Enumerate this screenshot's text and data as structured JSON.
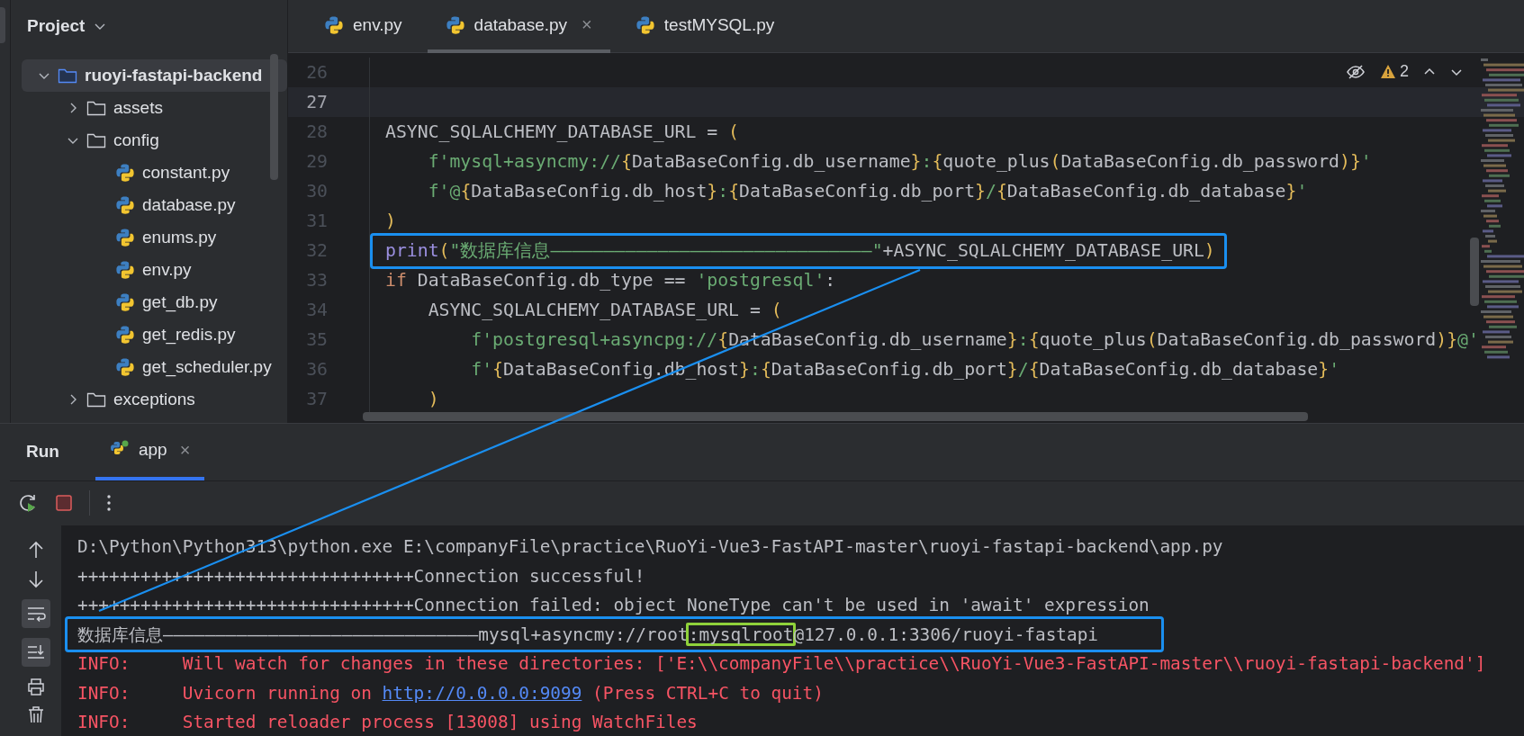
{
  "project_panel": {
    "title": "Project",
    "tree": [
      {
        "name": "ruoyi-fastapi-backend",
        "kind": "folder",
        "expanded": true,
        "selected": true,
        "children": [
          {
            "name": "assets",
            "kind": "folder",
            "expanded": false,
            "selected": false
          },
          {
            "name": "config",
            "kind": "folder",
            "expanded": true,
            "selected": false,
            "children": [
              {
                "name": "constant.py",
                "kind": "python",
                "selected": false
              },
              {
                "name": "database.py",
                "kind": "python",
                "selected": false
              },
              {
                "name": "enums.py",
                "kind": "python",
                "selected": false
              },
              {
                "name": "env.py",
                "kind": "python",
                "selected": false
              },
              {
                "name": "get_db.py",
                "kind": "python",
                "selected": false
              },
              {
                "name": "get_redis.py",
                "kind": "python",
                "selected": false
              },
              {
                "name": "get_scheduler.py",
                "kind": "python",
                "selected": false
              }
            ]
          },
          {
            "name": "exceptions",
            "kind": "folder",
            "expanded": false,
            "selected": false
          }
        ]
      }
    ]
  },
  "editor": {
    "tabs": [
      {
        "label": "env.py",
        "selected": false
      },
      {
        "label": "database.py",
        "selected": true,
        "close": "×"
      },
      {
        "label": "testMYSQL.py",
        "selected": false
      }
    ],
    "warnings": "2",
    "lines": [
      {
        "number": "26",
        "current": false
      },
      {
        "number": "27",
        "current": true
      },
      {
        "number": "28",
        "current": false,
        "tokens": [
          {
            "text": "ASYNC_SQLALCHEMY_DATABASE_URL = ",
            "kind": "plain"
          },
          {
            "text": "(",
            "kind": "brace"
          }
        ]
      },
      {
        "number": "29",
        "current": false,
        "tokens": [
          {
            "text": "    f'mysql+asyncmy://",
            "kind": "str"
          },
          {
            "text": "{",
            "kind": "brace"
          },
          {
            "text": "DataBaseConfig.db_username",
            "kind": "plain"
          },
          {
            "text": "}",
            "kind": "brace"
          },
          {
            "text": ":",
            "kind": "str"
          },
          {
            "text": "{",
            "kind": "brace"
          },
          {
            "text": "quote_plus",
            "kind": "plain"
          },
          {
            "text": "(",
            "kind": "brace"
          },
          {
            "text": "DataBaseConfig.db_password",
            "kind": "plain"
          },
          {
            "text": ")}",
            "kind": "brace"
          },
          {
            "text": "'",
            "kind": "str"
          }
        ]
      },
      {
        "number": "30",
        "current": false,
        "tokens": [
          {
            "text": "    f'@",
            "kind": "str"
          },
          {
            "text": "{",
            "kind": "brace"
          },
          {
            "text": "DataBaseConfig.db_host",
            "kind": "plain"
          },
          {
            "text": "}",
            "kind": "brace"
          },
          {
            "text": ":",
            "kind": "str"
          },
          {
            "text": "{",
            "kind": "brace"
          },
          {
            "text": "DataBaseConfig.db_port",
            "kind": "plain"
          },
          {
            "text": "}",
            "kind": "brace"
          },
          {
            "text": "/",
            "kind": "str"
          },
          {
            "text": "{",
            "kind": "brace"
          },
          {
            "text": "DataBaseConfig.db_database",
            "kind": "plain"
          },
          {
            "text": "}",
            "kind": "brace"
          },
          {
            "text": "'",
            "kind": "str"
          }
        ]
      },
      {
        "number": "31",
        "current": false,
        "tokens": [
          {
            "text": ")",
            "kind": "brace"
          }
        ]
      },
      {
        "number": "32",
        "current": false,
        "highlighted": true,
        "tokens": [
          {
            "text": "print",
            "kind": "fn"
          },
          {
            "text": "(",
            "kind": "brace"
          },
          {
            "text": "\"数据库信息——————————————————————————————\"",
            "kind": "str"
          },
          {
            "text": "+ASYNC_SQLALCHEMY_DATABASE_URL",
            "kind": "plain"
          },
          {
            "text": ")",
            "kind": "brace"
          }
        ]
      },
      {
        "number": "33",
        "current": false,
        "tokens": [
          {
            "text": "if",
            "kind": "kw"
          },
          {
            "text": " DataBaseConfig.db_type == ",
            "kind": "plain"
          },
          {
            "text": "'postgresql'",
            "kind": "str"
          },
          {
            "text": ":",
            "kind": "plain"
          }
        ]
      },
      {
        "number": "34",
        "current": false,
        "tokens": [
          {
            "text": "    ASYNC_SQLALCHEMY_DATABASE_URL = ",
            "kind": "plain"
          },
          {
            "text": "(",
            "kind": "brace"
          }
        ]
      },
      {
        "number": "35",
        "current": false,
        "tokens": [
          {
            "text": "        f'postgresql+asyncpg://",
            "kind": "str"
          },
          {
            "text": "{",
            "kind": "brace"
          },
          {
            "text": "DataBaseConfig.db_username",
            "kind": "plain"
          },
          {
            "text": "}",
            "kind": "brace"
          },
          {
            "text": ":",
            "kind": "str"
          },
          {
            "text": "{",
            "kind": "brace"
          },
          {
            "text": "quote_plus",
            "kind": "plain"
          },
          {
            "text": "(",
            "kind": "brace"
          },
          {
            "text": "DataBaseConfig.db_password",
            "kind": "plain"
          },
          {
            "text": ")}",
            "kind": "brace"
          },
          {
            "text": "@'",
            "kind": "str"
          }
        ]
      },
      {
        "number": "36",
        "current": false,
        "tokens": [
          {
            "text": "        f'",
            "kind": "str"
          },
          {
            "text": "{",
            "kind": "brace"
          },
          {
            "text": "DataBaseConfig.db_host",
            "kind": "plain"
          },
          {
            "text": "}",
            "kind": "brace"
          },
          {
            "text": ":",
            "kind": "str"
          },
          {
            "text": "{",
            "kind": "brace"
          },
          {
            "text": "DataBaseConfig.db_port",
            "kind": "plain"
          },
          {
            "text": "}",
            "kind": "brace"
          },
          {
            "text": "/",
            "kind": "str"
          },
          {
            "text": "{",
            "kind": "brace"
          },
          {
            "text": "DataBaseConfig.db_database",
            "kind": "plain"
          },
          {
            "text": "}",
            "kind": "brace"
          },
          {
            "text": "'",
            "kind": "str"
          }
        ]
      },
      {
        "number": "37",
        "current": false,
        "tokens": [
          {
            "text": "    )",
            "kind": "brace"
          }
        ]
      }
    ]
  },
  "run_panel": {
    "title": "Run",
    "tabs": [
      {
        "label": "app",
        "selected": true,
        "close": "×"
      }
    ],
    "console": [
      {
        "kind": "stdout",
        "segments": [
          {
            "text": "D:\\Python\\Python313\\python.exe E:\\companyFile\\practice\\RuoYi-Vue3-FastAPI-master\\ruoyi-fastapi-backend\\app.py",
            "kind": "text"
          }
        ]
      },
      {
        "kind": "stdout",
        "segments": [
          {
            "text": "++++++++++++++++++++++++++++++++Connection successful!",
            "kind": "text"
          }
        ]
      },
      {
        "kind": "stdout",
        "segments": [
          {
            "text": "++++++++++++++++++++++++++++++++Connection failed: object NoneType can't be used in 'await' expression",
            "kind": "text"
          }
        ]
      },
      {
        "kind": "stdout",
        "highlighted": true,
        "segments": [
          {
            "text": "数据库信息——————————————————————————————mysql+asyncmy://root",
            "kind": "text"
          },
          {
            "text": ":mysqlroot",
            "kind": "marked"
          },
          {
            "text": "@127.0.0.1:3306/ruoyi-fastapi",
            "kind": "text"
          }
        ]
      },
      {
        "kind": "stderr",
        "segments": [
          {
            "text": "INFO:     Will watch for changes in these directories: ['E:\\\\companyFile\\\\practice\\\\RuoYi-Vue3-FastAPI-master\\\\ruoyi-fastapi-backend']",
            "kind": "text"
          }
        ]
      },
      {
        "kind": "stderr",
        "segments": [
          {
            "text": "INFO:     Uvicorn running on ",
            "kind": "text"
          },
          {
            "text": "http://0.0.0.0:9099",
            "kind": "link"
          },
          {
            "text": " (Press CTRL+C to quit)",
            "kind": "text"
          }
        ]
      },
      {
        "kind": "stderr",
        "segments": [
          {
            "text": "INFO:     Started reloader process [13008] using WatchFiles",
            "kind": "text"
          }
        ]
      }
    ]
  }
}
